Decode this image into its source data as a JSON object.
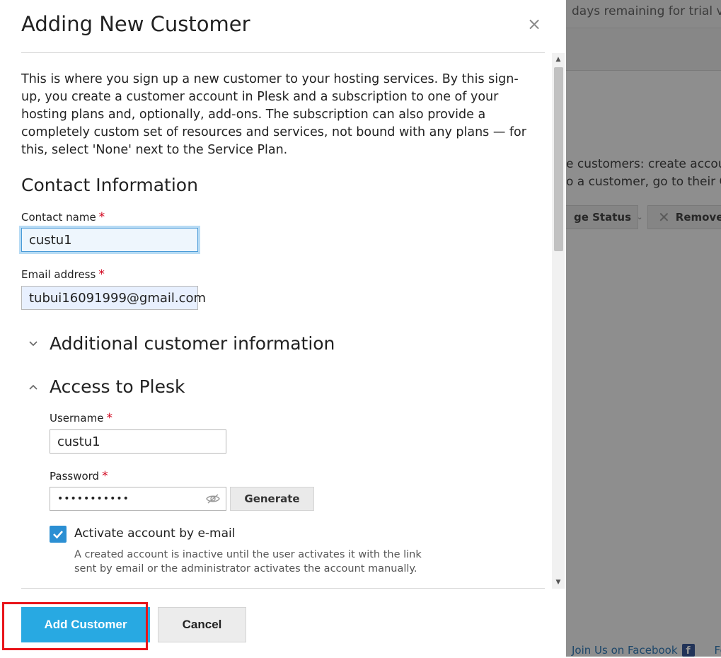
{
  "background": {
    "trial_text": "days remaining for trial ve",
    "desc_line1": "e customers: create accou",
    "desc_line2": "o a customer, go to their C",
    "change_status_label": "ge Status",
    "remove_label": "Remove",
    "footer_text": "Join Us on Facebook",
    "footer_icon_letter": "f",
    "footer_follow": "Foll"
  },
  "dialog": {
    "title": "Adding New Customer",
    "close_glyph": "×",
    "intro": "This is where you sign up a new customer to your hosting services. By this sign-up, you create a customer account in Plesk and a subscription to one of your hosting plans and, optionally, add-ons. The subscription can also provide a completely custom set of resources and services, not bound with any plans — for this, select 'None' next to the Service Plan.",
    "contact_section": {
      "heading": "Contact Information",
      "contact_name_label": "Contact name",
      "contact_name_value": "custu1",
      "email_label": "Email address",
      "email_value": "tubui16091999@gmail.com",
      "required_mark": "*"
    },
    "additional_section": {
      "heading": "Additional customer information",
      "expanded": false
    },
    "access_section": {
      "heading": "Access to Plesk",
      "expanded": true,
      "username_label": "Username",
      "username_value": "custu1",
      "password_label": "Password",
      "password_value": "•••••••••••",
      "generate_label": "Generate",
      "activate_label": "Activate account by e-mail",
      "activate_checked": true,
      "activate_hint": "A created account is inactive until the user activates it with the link sent by email or the administrator activates the account manually."
    },
    "footer": {
      "add_label": "Add Customer",
      "cancel_label": "Cancel"
    }
  },
  "colors": {
    "primary": "#28a9e2",
    "required": "#d0021b",
    "checkbox": "#2b8fd3",
    "highlight": "#e8141a"
  }
}
